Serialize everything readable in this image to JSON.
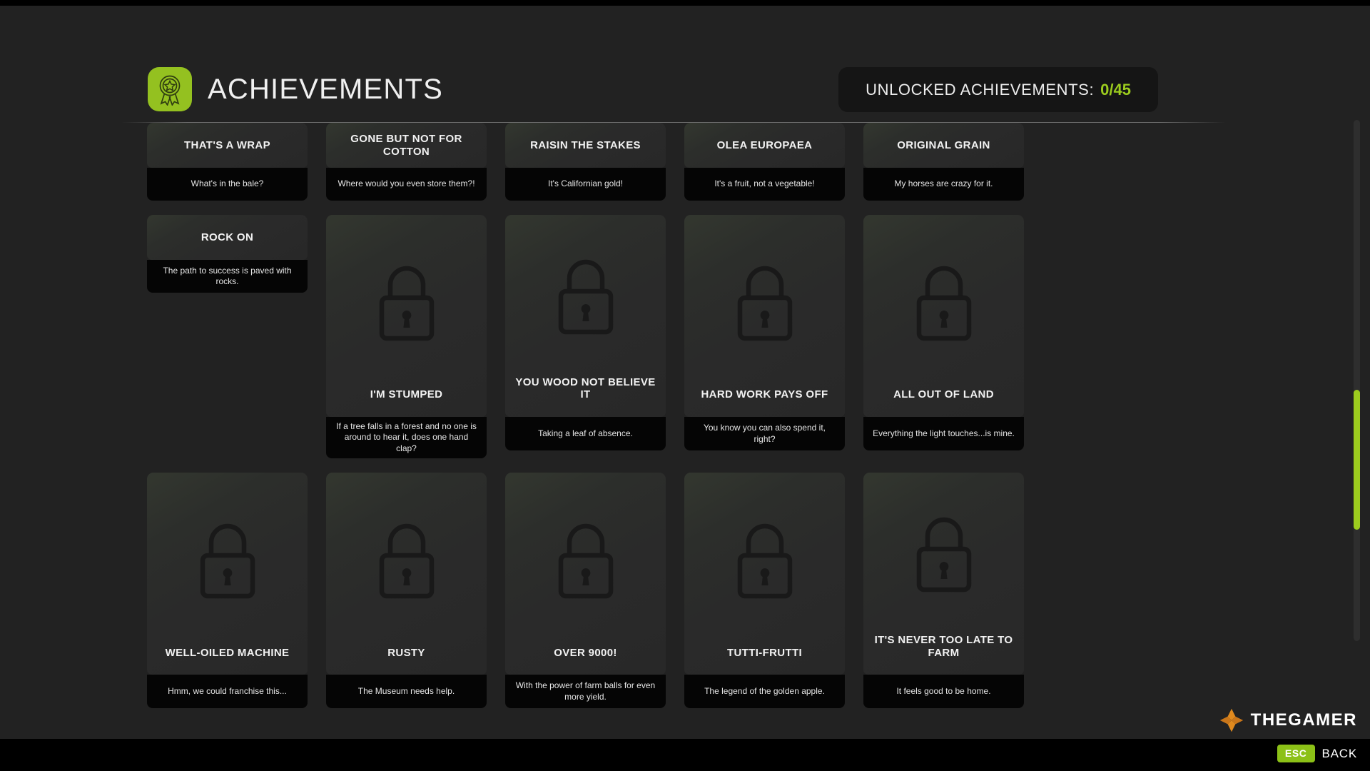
{
  "header": {
    "title": "ACHIEVEMENTS",
    "badge_icon": "award-ribbon-icon",
    "accent_color": "#94c120",
    "counter_label": "UNLOCKED ACHIEVEMENTS:",
    "counter_value": "0/45",
    "counter_value_color": "#9ccc1e"
  },
  "achievements": [
    {
      "title": "THAT'S A WRAP",
      "description": "What's in the bale?",
      "locked": true,
      "state": "partial"
    },
    {
      "title": "GONE BUT NOT FOR COTTON",
      "description": "Where would you even store them?!",
      "locked": true,
      "state": "partial"
    },
    {
      "title": "RAISIN THE STAKES",
      "description": "It's Californian gold!",
      "locked": true,
      "state": "partial"
    },
    {
      "title": "OLEA EUROPAEA",
      "description": "It's a fruit, not a vegetable!",
      "locked": true,
      "state": "partial"
    },
    {
      "title": "ORIGINAL GRAIN",
      "description": "My horses are crazy for it.",
      "locked": true,
      "state": "partial"
    },
    {
      "title": "ROCK ON",
      "description": "The path to success is paved with rocks.",
      "locked": true,
      "state": "partial"
    },
    {
      "title": "I'M STUMPED",
      "description": "If a tree falls in a forest and no one is around to hear it, does one hand clap?",
      "locked": true,
      "state": "full"
    },
    {
      "title": "YOU WOOD NOT BELIEVE IT",
      "description": "Taking a leaf of absence.",
      "locked": true,
      "state": "full"
    },
    {
      "title": "HARD WORK PAYS OFF",
      "description": "You know you can also spend it, right?",
      "locked": true,
      "state": "full"
    },
    {
      "title": "ALL OUT OF LAND",
      "description": "Everything the light touches...is mine.",
      "locked": true,
      "state": "full"
    },
    {
      "title": "WELL-OILED MACHINE",
      "description": "Hmm, we could franchise this...",
      "locked": true,
      "state": "full"
    },
    {
      "title": "RUSTY",
      "description": "The Museum needs help.",
      "locked": true,
      "state": "full"
    },
    {
      "title": "OVER 9000!",
      "description": "With the power of farm balls for even more yield.",
      "locked": true,
      "state": "tall"
    },
    {
      "title": "TUTTI-FRUTTI",
      "description": "The legend of the golden apple.",
      "locked": true,
      "state": "tall"
    },
    {
      "title": "IT'S NEVER TOO LATE TO FARM",
      "description": "It feels good to be home.",
      "locked": true,
      "state": "tall"
    }
  ],
  "scrollbar": {
    "icon": "vertical-scrollbar",
    "thumb_color": "#9ccc1e"
  },
  "watermark": {
    "brand": "THEGAMER",
    "icon": "thegamer-diamond-icon"
  },
  "footer": {
    "key": "ESC",
    "action": "BACK",
    "key_color": "#8cc117"
  }
}
